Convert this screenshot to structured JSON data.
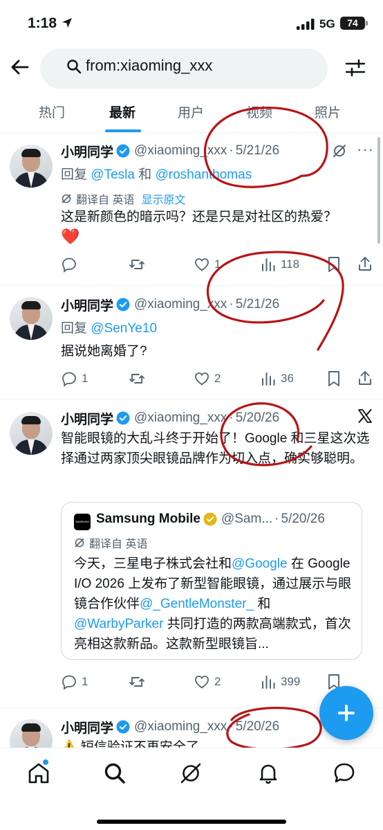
{
  "status_bar": {
    "time": "1:18",
    "network": "5G",
    "battery": "74"
  },
  "search": {
    "query": "from:xiaoming_xxx"
  },
  "tabs": [
    "热门",
    "最新",
    "用户",
    "视频",
    "照片"
  ],
  "tweets": [
    {
      "name": "小明同学",
      "handle": "@xiaoming_xxx",
      "date": "5/21/26",
      "reply_prefix": "回复 ",
      "reply_mention_1": "@Tesla",
      "reply_and": " 和 ",
      "reply_mention_2": "@roshanthomas",
      "translate_label": "翻译自 英语",
      "show_original": "显示原文",
      "text": "这是新颜色的暗示吗？还是只是对社区的热爱？",
      "emoji": "❤️",
      "replies": "",
      "retweets": "",
      "likes": "1",
      "views": "118"
    },
    {
      "name": "小明同学",
      "handle": "@xiaoming_xxx",
      "date": "5/21/26",
      "reply_prefix": "回复 ",
      "reply_mention_1": "@SenYe10",
      "text": "据说她离婚了?",
      "replies": "1",
      "retweets": "",
      "likes": "2",
      "views": "36"
    },
    {
      "name": "小明同学",
      "handle": "@xiaoming_xxx",
      "date": "5/20/26",
      "text": "智能眼镜的大乱斗终于开始了！Google 和三星这次选择通过两家顶尖眼镜品牌作为切入点，确实够聪明。",
      "replies": "1",
      "retweets": "",
      "likes": "2",
      "views": "399",
      "quote": {
        "logo_text": "SAMSUNG Galaxy",
        "name": "Samsung Mobile",
        "handle": "@Sam...",
        "date": "5/20/26",
        "translate_label": "翻译自 英语",
        "text_1": "今天，三星电子株式会社和",
        "link_1": "@Google",
        "text_2": " 在 Google I/O 2026 上发布了新型智能眼镜，通过展示与眼镜合作伙伴",
        "link_2": "@_GentleMonster_",
        "text_3": " 和",
        "link_3": "@WarbyParker",
        "text_4": " 共同打造的两款高端款式，首次亮相这款新品。这款新型眼镜旨..."
      }
    },
    {
      "name": "小明同学",
      "handle": "@xiaoming_xxx",
      "date": "5/20/26",
      "text": "⚠️ 短信验证不再安全了"
    }
  ],
  "colors": {
    "accent": "#1d9bf0",
    "text": "#0f1419",
    "muted": "#536471",
    "verified_blue": "#1d9bf0",
    "verified_gold": "#e2b719",
    "annotation": "#b81414"
  }
}
